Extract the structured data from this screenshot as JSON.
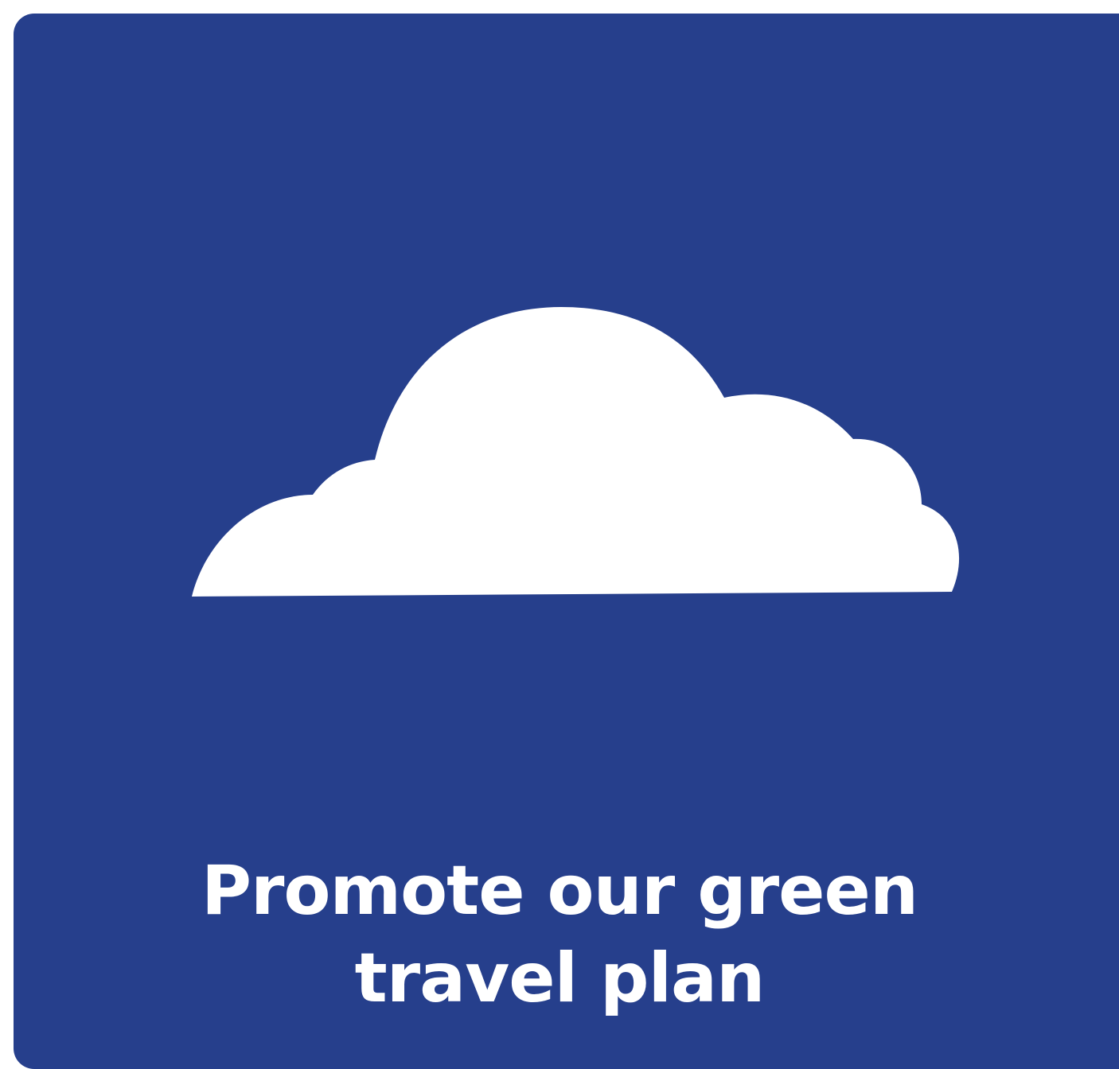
{
  "tile": {
    "background_color": "#263f8c",
    "icon": "cloud-icon",
    "icon_color": "#ffffff",
    "caption_lines": [
      "Promote our green",
      "travel plan"
    ]
  }
}
